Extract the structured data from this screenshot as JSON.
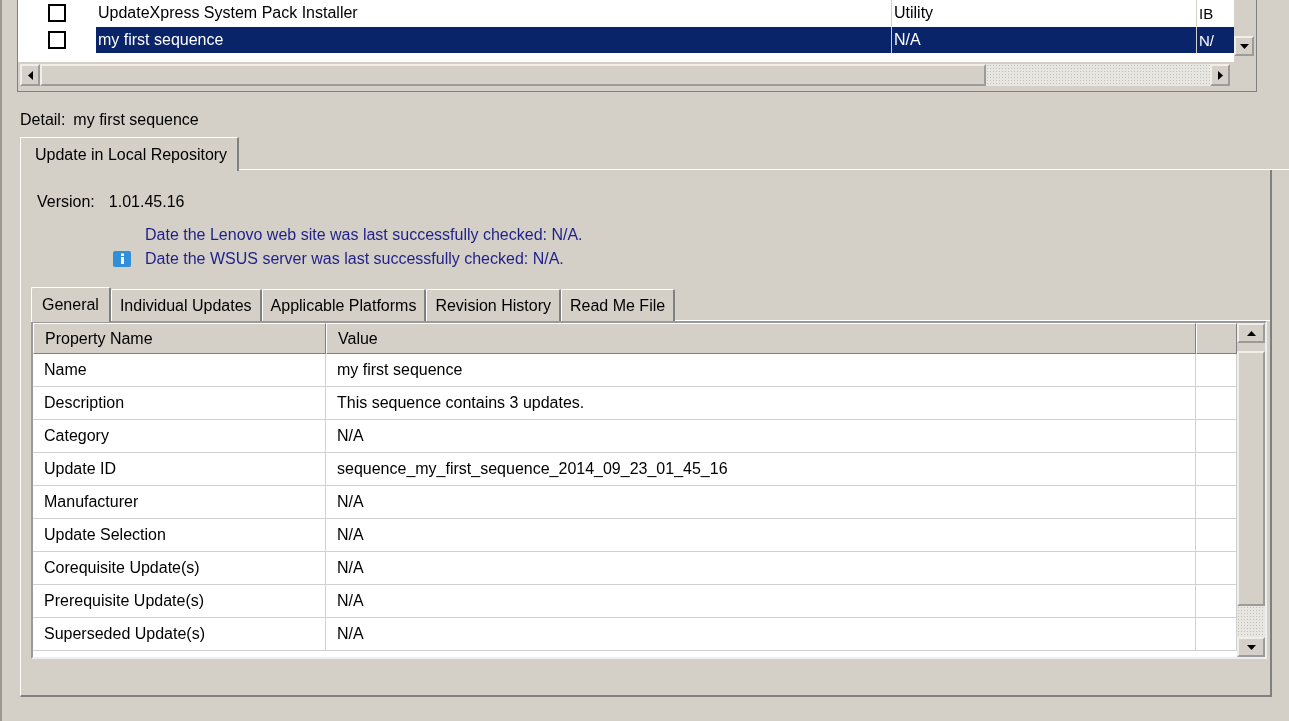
{
  "top_list": {
    "rows": [
      {
        "checked": false,
        "selected": false,
        "cells": [
          "UpdateXpress System Pack Installer",
          "Utility",
          "IB"
        ]
      },
      {
        "checked": false,
        "selected": true,
        "cells": [
          "my first sequence",
          "N/A",
          "N/"
        ]
      }
    ]
  },
  "detail": {
    "label": "Detail:",
    "value": "my first sequence"
  },
  "outer_tabs": [
    {
      "label": "Update in Local Repository",
      "selected": true
    }
  ],
  "version": {
    "label": "Version:",
    "value": "1.01.45.16"
  },
  "info_lines": [
    "Date the Lenovo web site was last successfully checked: N/A.",
    "Date the WSUS server was last successfully checked: N/A."
  ],
  "inner_tabs": [
    {
      "label": "General",
      "selected": true
    },
    {
      "label": "Individual Updates",
      "selected": false
    },
    {
      "label": "Applicable Platforms",
      "selected": false
    },
    {
      "label": "Revision History",
      "selected": false
    },
    {
      "label": "Read Me File",
      "selected": false
    }
  ],
  "properties": {
    "columns": [
      "Property Name",
      "Value"
    ],
    "rows": [
      {
        "name": "Name",
        "value": "my first sequence"
      },
      {
        "name": "Description",
        "value": "This sequence contains 3 updates."
      },
      {
        "name": "Category",
        "value": "N/A"
      },
      {
        "name": "Update ID",
        "value": "sequence_my_first_sequence_2014_09_23_01_45_16"
      },
      {
        "name": "Manufacturer",
        "value": "N/A"
      },
      {
        "name": "Update Selection",
        "value": "N/A"
      },
      {
        "name": "Corequisite Update(s)",
        "value": "N/A"
      },
      {
        "name": "Prerequisite Update(s)",
        "value": "N/A"
      },
      {
        "name": "Superseded Update(s)",
        "value": "N/A"
      }
    ]
  }
}
